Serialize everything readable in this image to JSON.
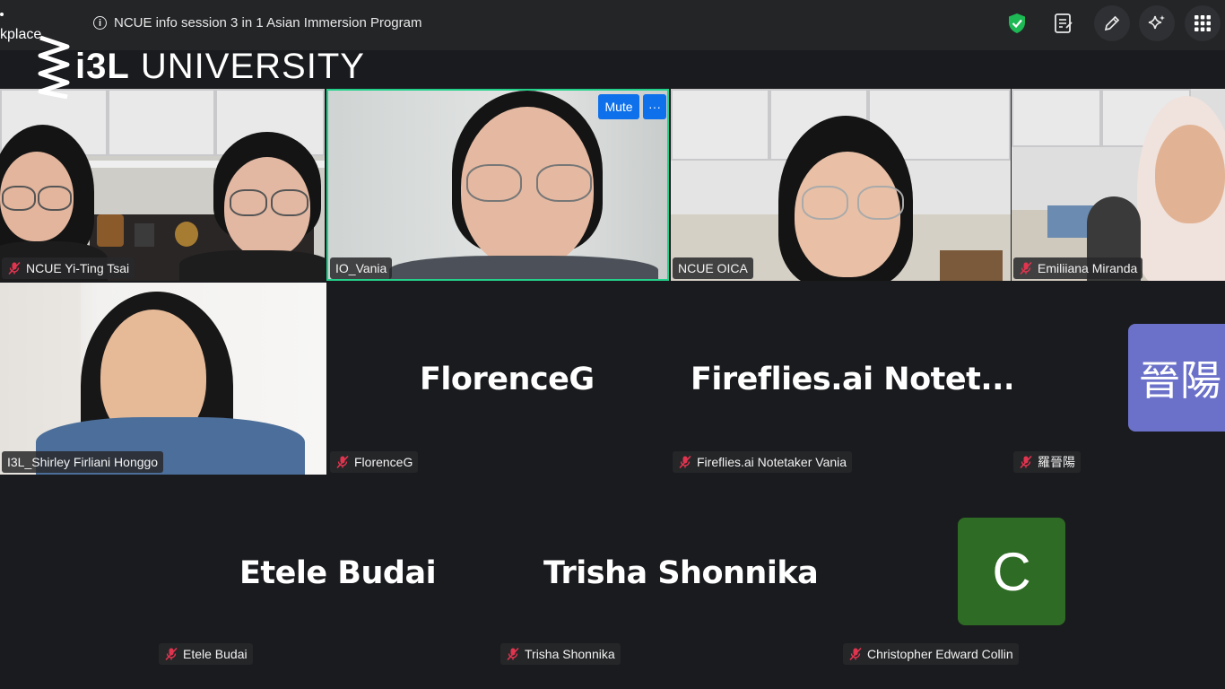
{
  "topbar": {
    "workplace_label": "kplace",
    "meeting_title": "NCUE info session 3 in 1 Asian Immersion Program",
    "icons": [
      "info-icon",
      "shield-check-icon",
      "notes-icon",
      "pencil-icon",
      "sparkle-icon",
      "grid-apps-icon"
    ]
  },
  "logo": {
    "brand_bold": "i3L",
    "brand_text": " UNIVERSITY"
  },
  "colors": {
    "background": "#1a1b1e",
    "active_speaker_border": "#23d18b",
    "mute_button": "#0e71eb",
    "muted_icon": "#e0344f",
    "avatar_purple": "#6b71c9",
    "avatar_green": "#2e6b24",
    "shield_green": "#1db954"
  },
  "tiles": {
    "t1": {
      "name": "NCUE Yi-Ting Tsai",
      "muted": true
    },
    "t2": {
      "name": "IO_Vania",
      "muted": false,
      "mute_label": "Mute",
      "more_label": "···"
    },
    "t3": {
      "name": "NCUE OICA",
      "muted": false
    },
    "t4": {
      "name": "Emiliiana  Miranda",
      "muted": true
    },
    "t5": {
      "name": "I3L_Shirley Firliani Honggo",
      "muted": false
    },
    "t6": {
      "name": "FlorenceG",
      "big": "FlorenceG",
      "muted": true
    },
    "t7": {
      "name": "Fireflies.ai Notetaker Vania",
      "big": "Fireflies.ai  Notet...",
      "muted": true
    },
    "t8": {
      "name": "羅晉陽",
      "avatar": "晉陽",
      "muted": true
    },
    "t9": {
      "name": "Etele Budai",
      "big": "Etele Budai",
      "muted": true
    },
    "t10": {
      "name": "Trisha Shonnika",
      "big": "Trisha Shonnika",
      "muted": true
    },
    "t11": {
      "name": "Christopher Edward Collin",
      "avatar": "C",
      "muted": true
    }
  }
}
